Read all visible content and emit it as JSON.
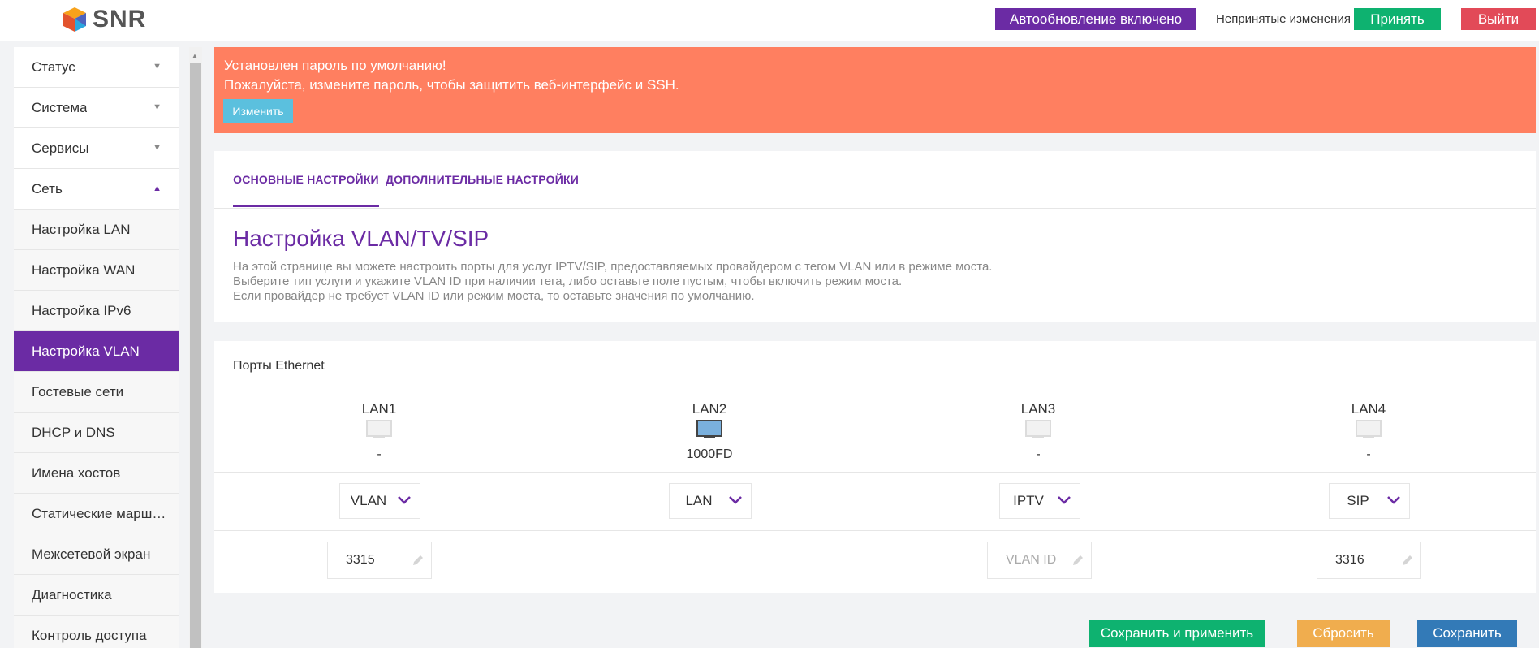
{
  "header": {
    "logo_text": "SNR",
    "auto_update_label": "Автообновление включено",
    "unsaved_label": "Непринятые изменения",
    "accept_label": "Принять",
    "logout_label": "Выйти"
  },
  "sidebar": {
    "items": [
      {
        "label": "Статус",
        "caret": "▼"
      },
      {
        "label": "Система",
        "caret": "▼"
      },
      {
        "label": "Сервисы",
        "caret": "▼"
      },
      {
        "label": "Сеть",
        "caret": "▲"
      }
    ],
    "subitems": [
      {
        "label": "Настройка LAN"
      },
      {
        "label": "Настройка WAN"
      },
      {
        "label": "Настройка IPv6"
      },
      {
        "label": "Настройка VLAN"
      },
      {
        "label": "Гостевые сети"
      },
      {
        "label": "DHCP и DNS"
      },
      {
        "label": "Имена хостов"
      },
      {
        "label": "Статические маршруты"
      },
      {
        "label": "Межсетевой экран"
      },
      {
        "label": "Диагностика"
      },
      {
        "label": "Контроль доступа"
      }
    ]
  },
  "alert": {
    "line1": "Установлен пароль по умолчанию!",
    "line2": "Пожалуйста, измените пароль, чтобы защитить веб-интерфейс и SSH.",
    "change_label": "Изменить"
  },
  "tabs": {
    "basic": "ОСНОВНЫЕ НАСТРОЙКИ",
    "advanced": "ДОПОЛНИТЕЛЬНЫЕ НАСТРОЙКИ"
  },
  "page": {
    "title": "Настройка VLAN/TV/SIP",
    "desc1": "На этой странице вы можете настроить порты для услуг IPTV/SIP, предоставляемых провайдером с тегом VLAN или в режиме моста.",
    "desc2": "Выберите тип услуги и укажите VLAN ID при наличии тега, либо оставьте поле пустым, чтобы включить режим моста.",
    "desc3": "Если провайдер не требует VLAN ID или режим моста, то оставьте значения по умолчанию."
  },
  "ports": {
    "heading": "Порты Ethernet",
    "list": [
      {
        "name": "LAN1",
        "status": "-",
        "type": "VLAN",
        "vlan_id": "3315",
        "connected": false
      },
      {
        "name": "LAN2",
        "status": "1000FD",
        "type": "LAN",
        "vlan_id": "",
        "connected": true
      },
      {
        "name": "LAN3",
        "status": "-",
        "type": "IPTV",
        "vlan_id": "",
        "placeholder": "VLAN ID",
        "connected": false
      },
      {
        "name": "LAN4",
        "status": "-",
        "type": "SIP",
        "vlan_id": "3316",
        "connected": false
      }
    ]
  },
  "footer": {
    "save_apply_label": "Сохранить и применить",
    "reset_label": "Сбросить",
    "save_label": "Сохранить"
  },
  "colors": {
    "accent": "#6b2ba4",
    "success": "#0eb270",
    "danger": "#e24a58",
    "alert": "#ff7f60",
    "info": "#5bc0de",
    "warning": "#f0ad4e",
    "primary": "#337ab7"
  }
}
